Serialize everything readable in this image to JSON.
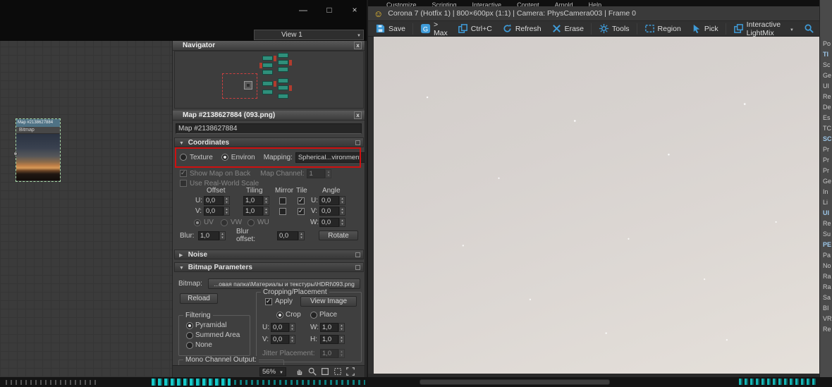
{
  "window_controls": {
    "minimize": "—",
    "maximize": "□",
    "close": "×"
  },
  "menubar": {
    "items": [
      "Customize",
      "Scripting",
      "Interactive",
      "Content",
      "Arnold",
      "Help"
    ]
  },
  "material_editor": {
    "view_selector": "View 1",
    "navigator_title": "Navigator",
    "close_glyph": "x",
    "node": {
      "title": "Map #2138627884",
      "type": "Bitmap"
    },
    "statusbar": {
      "zoom": "56%"
    }
  },
  "map_panel": {
    "header": "Map #2138627884 (093.png)",
    "name_field": "Map #2138627884"
  },
  "coordinates": {
    "header": "Coordinates",
    "texture": "Texture",
    "environ": "Environ",
    "mapping_label": "Mapping:",
    "mapping_value": "Spherical...vironment",
    "show_map_on_back": "Show Map on Back",
    "map_channel_label": "Map Channel:",
    "map_channel_value": "1",
    "use_real_world_scale": "Use Real-World Scale",
    "col_offset": "Offset",
    "col_tiling": "Tiling",
    "col_mirror": "Mirror",
    "col_tile": "Tile",
    "col_angle": "Angle",
    "u": "U:",
    "v": "V:",
    "w": "W:",
    "u_offset": "0,0",
    "u_tiling": "1,0",
    "v_offset": "0,0",
    "v_tiling": "1,0",
    "angle_u": "0,0",
    "angle_v": "0,0",
    "angle_w": "0,0",
    "uv": "UV",
    "vw": "VW",
    "wu": "WU",
    "blur_label": "Blur:",
    "blur_value": "1,0",
    "blur_offset_label": "Blur offset:",
    "blur_offset_value": "0,0",
    "rotate": "Rotate"
  },
  "noise": {
    "header": "Noise"
  },
  "bitmap_params": {
    "header": "Bitmap Parameters",
    "bitmap_label": "Bitmap:",
    "bitmap_path": "...овая папка\\Материалы и текстуры\\HDRI\\093.png",
    "reload": "Reload",
    "filtering_title": "Filtering",
    "filtering_options": [
      "Pyramidal",
      "Summed Area",
      "None"
    ],
    "mono_title": "Mono Channel Output:",
    "cropping_title": "Cropping/Placement",
    "apply": "Apply",
    "view_image": "View Image",
    "crop": "Crop",
    "place": "Place",
    "u_label": "U:",
    "u_value": "0,0",
    "w_label": "W:",
    "w_value": "1,0",
    "v_label": "V:",
    "v_value": "0,0",
    "h_label": "H:",
    "h_value": "1,0",
    "jitter_label": "Jitter Placement:",
    "jitter_value": "1,0"
  },
  "vfb": {
    "title": "Corona 7 (Hotfix 1) | 800×600px (1:1) | Camera: PhysCamera003 | Frame 0",
    "toolbar": {
      "save": "Save",
      "max": "> Max",
      "copy": "Ctrl+C",
      "refresh": "Refresh",
      "erase": "Erase",
      "tools": "Tools",
      "region": "Region",
      "pick": "Pick",
      "lightmix": "Interactive LightMix"
    }
  },
  "command_panel": {
    "labels": [
      "Po",
      "TI",
      "Sc",
      "Ge",
      "UI",
      "Re",
      "De",
      "Es",
      "TC",
      "SC",
      "Pr",
      "Pr",
      "Pr",
      "Ge",
      "In",
      "Li",
      "UI",
      "Re",
      "Su",
      "PE",
      "Pa",
      "No",
      "Ra",
      "Ra",
      "Sa",
      "BI",
      "VR",
      "Re"
    ]
  }
}
